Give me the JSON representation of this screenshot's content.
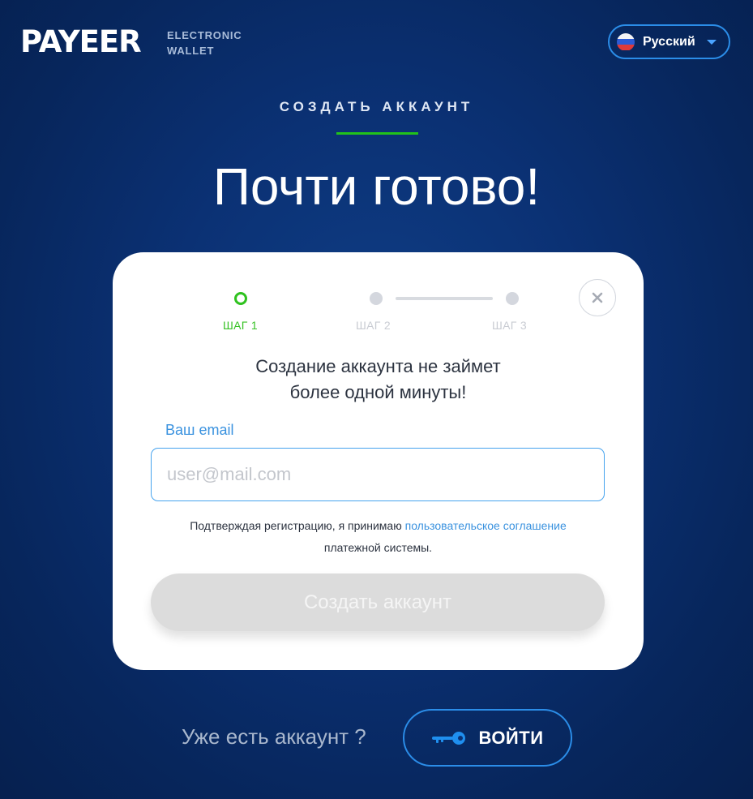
{
  "header": {
    "logo_text": "PAYEER",
    "logo_reg": "®",
    "tagline_line1": "ELECTRONIC",
    "tagline_line2": "WALLET",
    "language": {
      "selected": "Русский",
      "flag_icon": "russia-flag-icon",
      "caret_icon": "chevron-down-icon"
    }
  },
  "hero": {
    "section_title": "СОЗДАТЬ АККАУНТ",
    "heading": "Почти готово!"
  },
  "card": {
    "close_icon": "close-icon",
    "steps": [
      {
        "label": "ШАГ 1",
        "state": "active"
      },
      {
        "label": "ШАГ 2",
        "state": "pending"
      },
      {
        "label": "ШАГ 3",
        "state": "pending"
      }
    ],
    "subtitle_line1": "Создание аккаунта не займет",
    "subtitle_line2": "более одной минуты!",
    "email_label": "Ваш email",
    "email_placeholder": "user@mail.com",
    "email_value": "",
    "terms_prefix": "Подтверждая регистрацию, я принимаю",
    "terms_link": "пользовательское соглашение",
    "terms_suffix": "платежной системы.",
    "submit_label": "Создать аккаунт"
  },
  "footer": {
    "question": "Уже есть аккаунт ?",
    "login_label": "ВОЙТИ",
    "login_icon": "key-icon"
  },
  "colors": {
    "background": "#0b3174",
    "accent_blue": "#2b8de8",
    "accent_green": "#22c21a",
    "link_blue": "#3a92df",
    "disabled_button": "#dcdcdc"
  }
}
